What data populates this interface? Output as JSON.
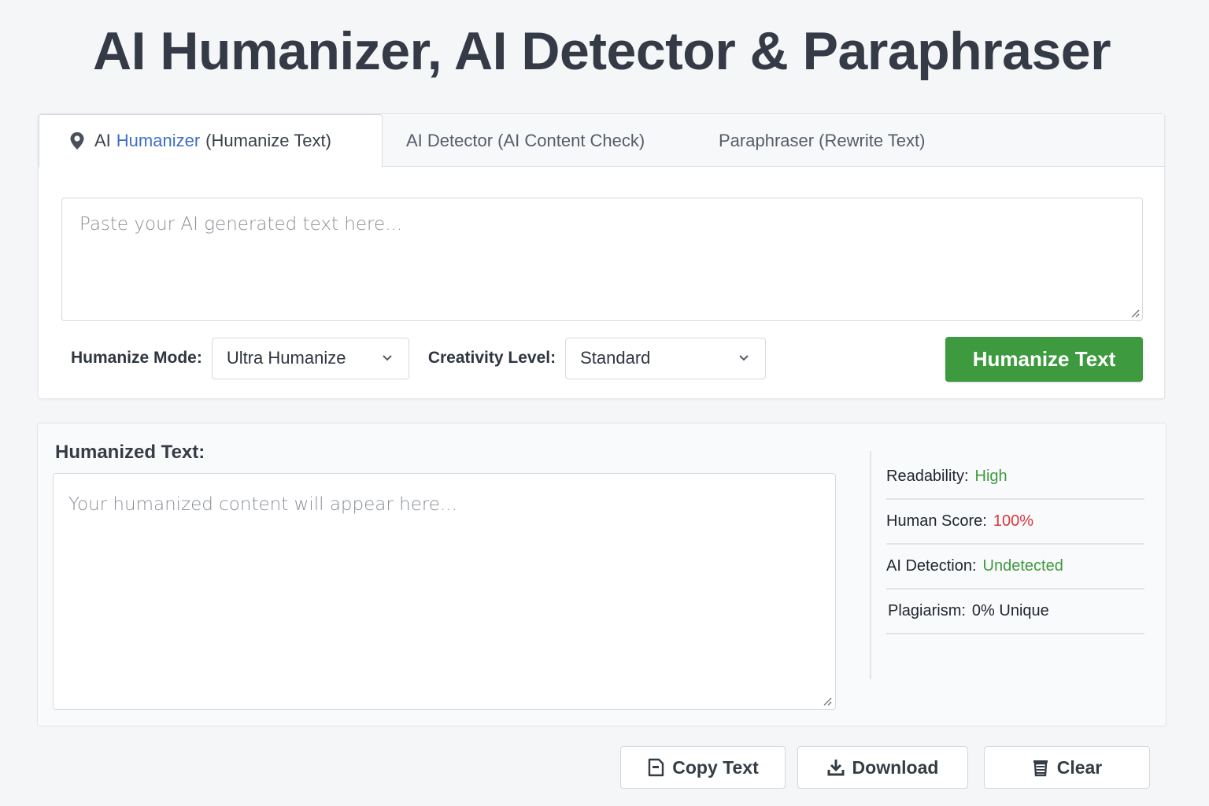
{
  "page": {
    "title": "AI Humanizer, AI Detector & Paraphraser"
  },
  "tabs": {
    "humanizer": {
      "prefix": "AI",
      "highlight": "Humanizer",
      "suffix": "(Humanize Text)"
    },
    "detector": {
      "label": "AI Detector (AI Content Check)"
    },
    "paraphraser": {
      "label": "Paraphraser (Rewrite Text)"
    }
  },
  "input": {
    "placeholder": "Paste your AI generated text here..."
  },
  "controls": {
    "mode_label": "Humanize Mode:",
    "mode_value": "Ultra Humanize",
    "creativity_label": "Creativity Level:",
    "creativity_value": "Standard",
    "submit_label": "Humanize Text"
  },
  "output": {
    "title": "Humanized Text:",
    "placeholder": "Your humanized content will appear here..."
  },
  "stats": [
    {
      "label": "Readability:",
      "value": "High",
      "color": "#3e9a3e"
    },
    {
      "label": "Human Score:",
      "value": "100%",
      "color": "#d8373c"
    },
    {
      "label": "AI Detection:",
      "value": "Undetected",
      "color": "#3e9a3e"
    },
    {
      "label": "Plagiarism:",
      "value": "0% Unique",
      "color": "#1f252d"
    }
  ],
  "actions": {
    "copy_label": "Copy Text",
    "download_label": "Download",
    "clear_label": "Clear"
  },
  "colors": {
    "accent_green": "#3e9a3e",
    "accent_blue": "#3f6fc4",
    "accent_red": "#d8373c"
  }
}
